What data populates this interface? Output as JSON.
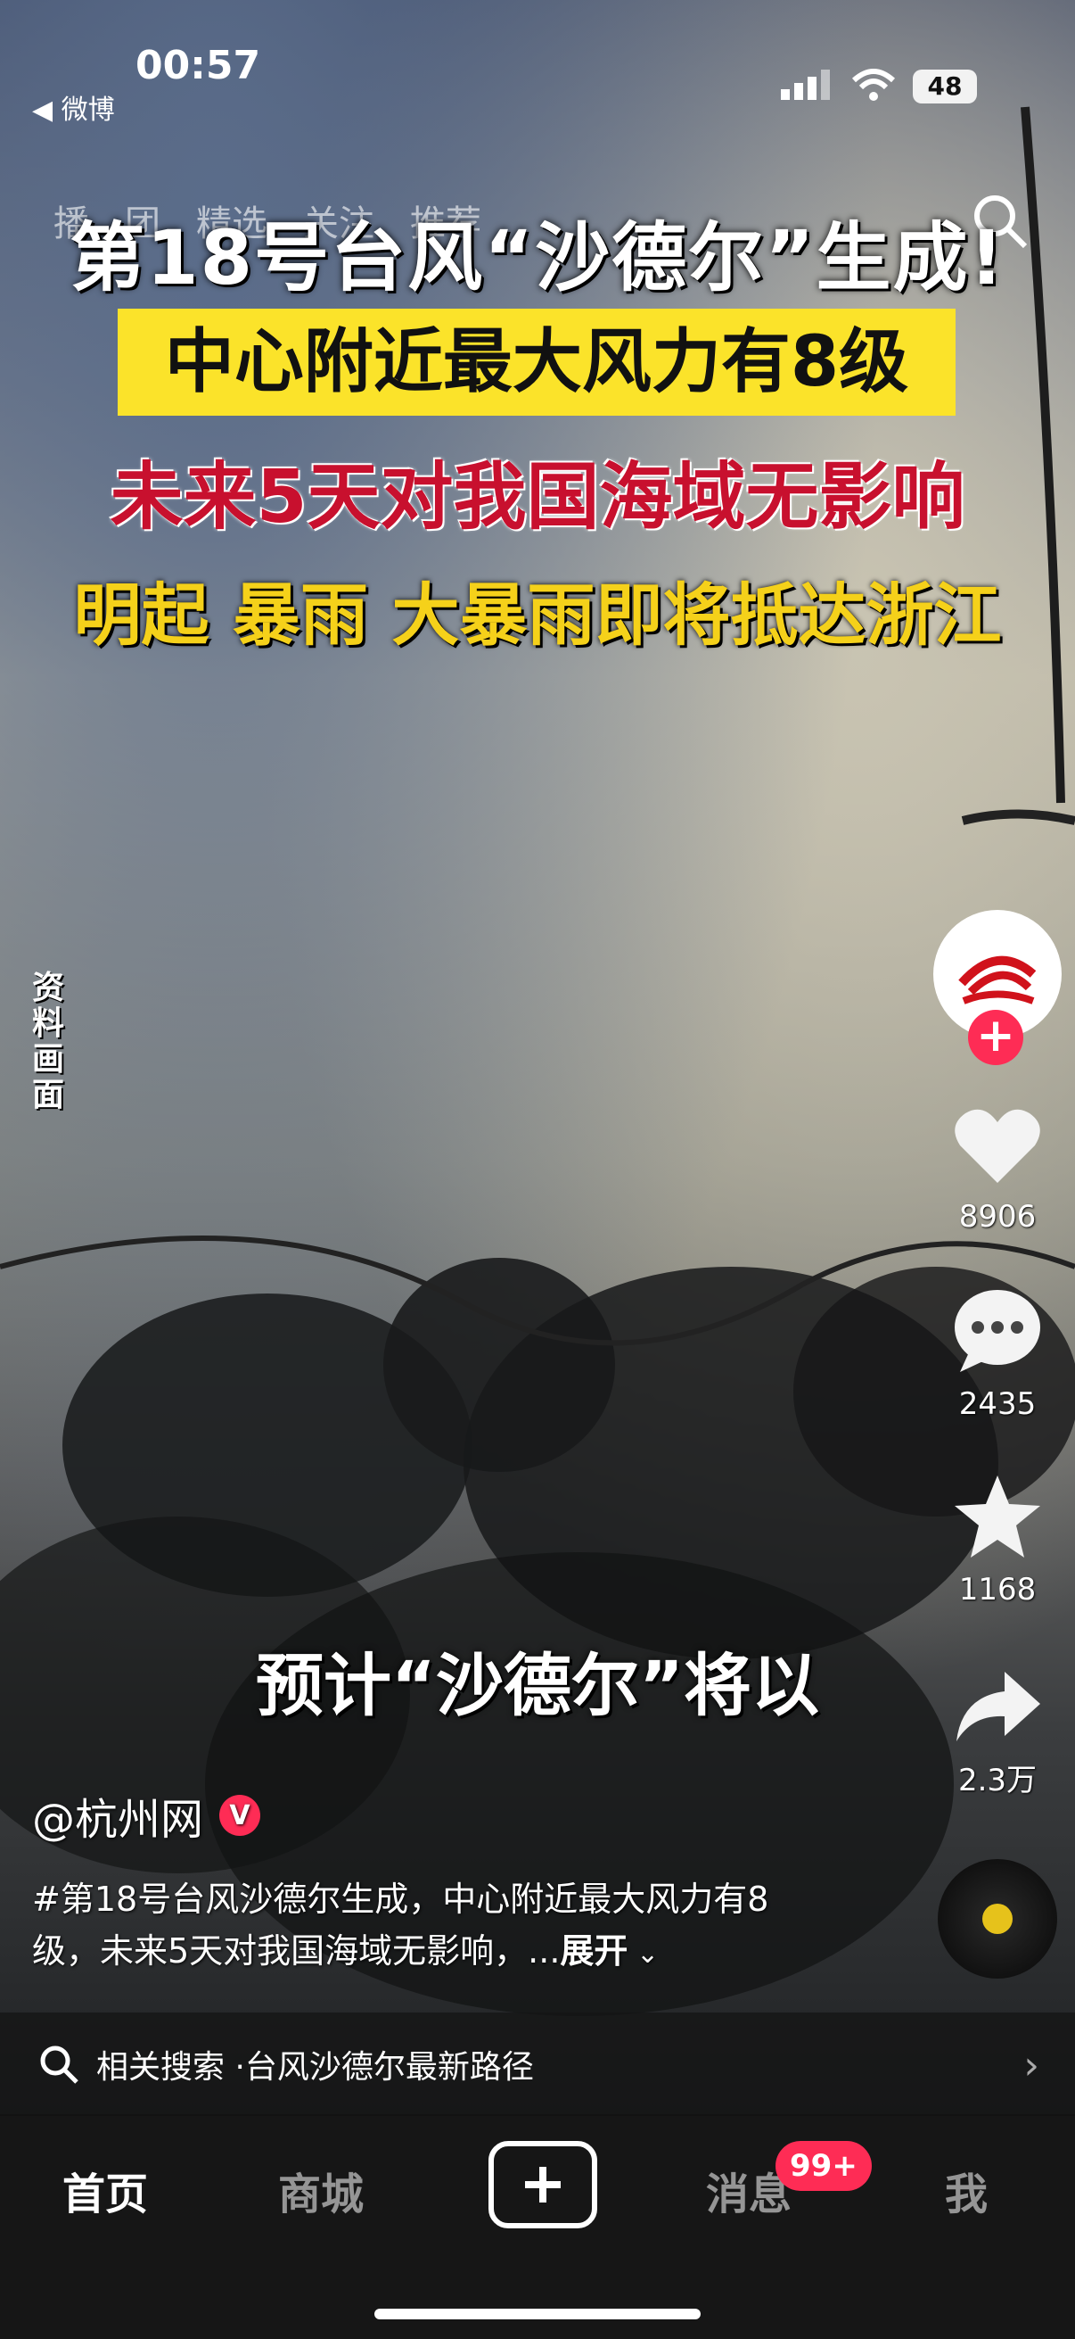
{
  "status_bar": {
    "time": "00:57",
    "back_app": "◀ 微博",
    "battery": "48"
  },
  "top_tabs": [
    "播",
    "团",
    "精选",
    "关注",
    "推荐"
  ],
  "video_overlay": {
    "headline1": "第18号台风“沙德尔”生成!",
    "headline2": "中心附近最大风力有8级",
    "headline3": "未来5天对我国海域无影响",
    "headline4": "明起 暴雨 大暴雨即将抵达浙江",
    "side_label": "资料画面",
    "subtitle": "预计“沙德尔”将以"
  },
  "action_rail": {
    "like_count": "8906",
    "comment_count": "2435",
    "favorite_count": "1168",
    "share_count": "2.3万"
  },
  "post": {
    "author": "@杭州网",
    "verified_badge": "V",
    "description": "#第18号台风沙德尔生成，中心附近最大风力有8级，未来5天对我国海域无影响，...",
    "expand_label": "展开"
  },
  "related_search": {
    "prefix": "相关搜索 · ",
    "query": "台风沙德尔最新路径"
  },
  "bottom_nav": {
    "home": "首页",
    "mall": "商城",
    "messages": "消息",
    "messages_badge": "99+",
    "me": "我"
  },
  "colors": {
    "accent_red": "#fe2c55",
    "headline_yellow_bg": "#fbe32a",
    "headline_red": "#c8102e",
    "headline_yellow": "#f5d11a"
  }
}
